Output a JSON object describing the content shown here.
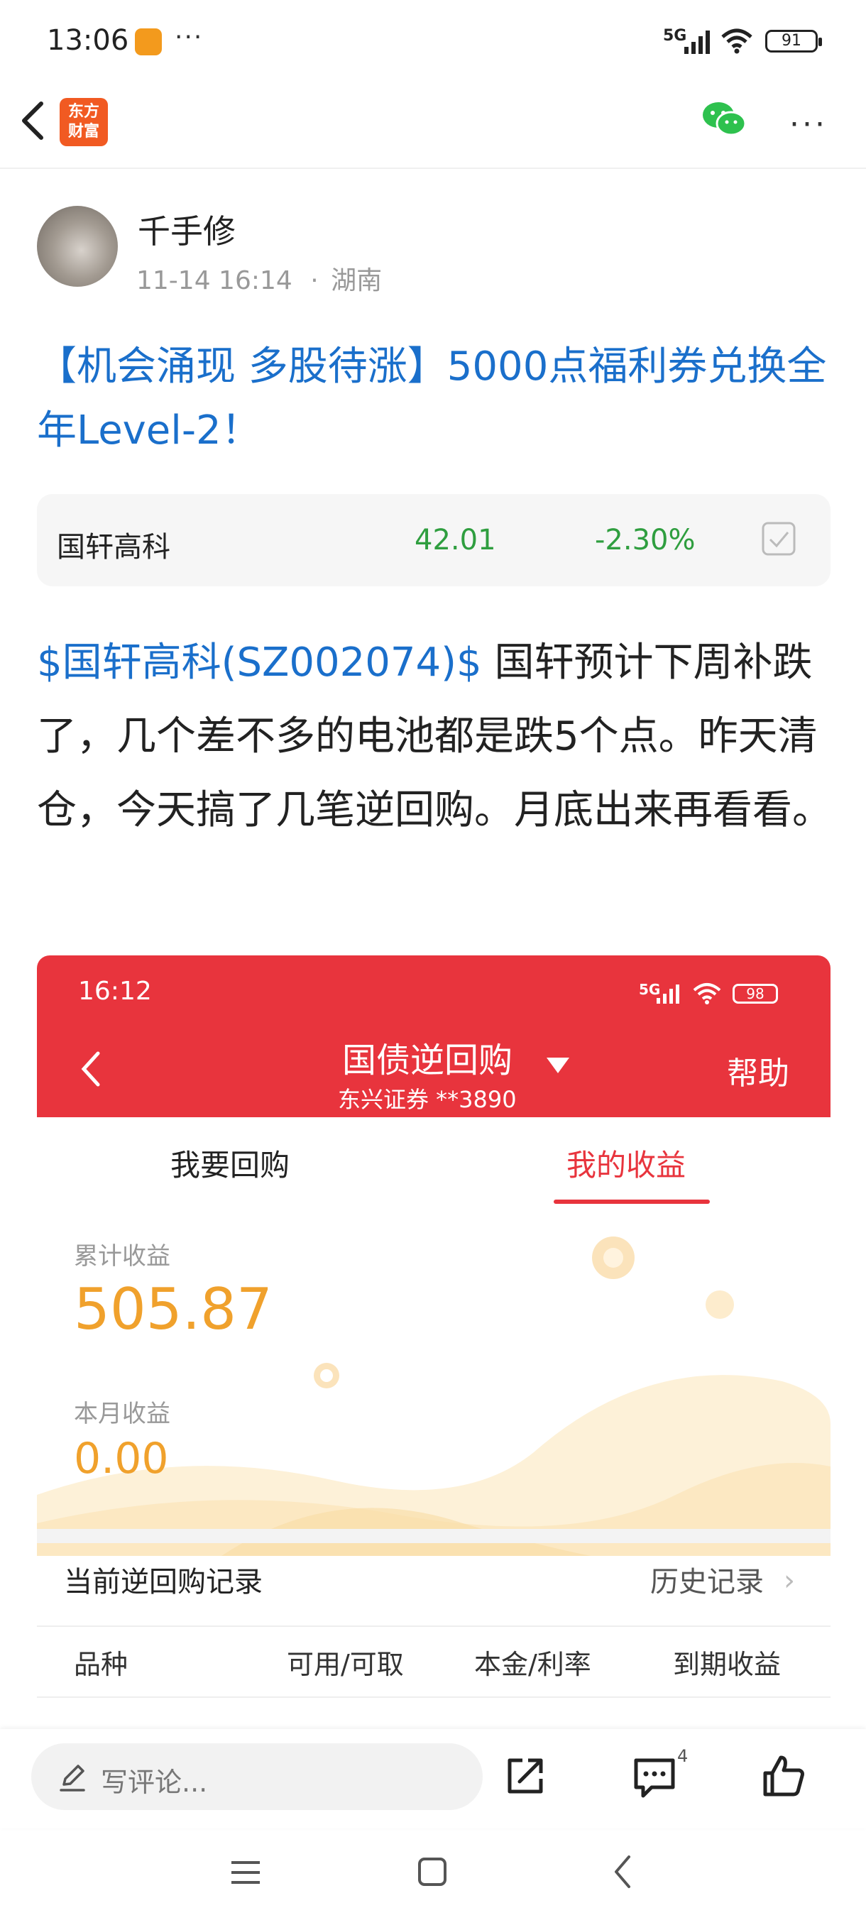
{
  "status_bar": {
    "time": "13:06",
    "dots": "···",
    "network": "5G",
    "battery": "91"
  },
  "nav": {
    "logo_line1": "东方",
    "logo_line2": "财富",
    "more": "···"
  },
  "post": {
    "author": "千手修",
    "time": "11-14 16:14",
    "location_sep": "·",
    "location": "湖南",
    "title": "【机会涌现 多股待涨】5000点福利券兑换全年Level-2！",
    "stock": {
      "name": "国轩高科",
      "price": "42.01",
      "change": "-2.30%"
    },
    "body_link": "$国轩高科(SZ002074)$",
    "body_text": " 国轩预计下周补跌了，几个差不多的电池都是跌5个点。昨天清仓，今天搞了几笔逆回购。月底出来再看看。"
  },
  "embedded": {
    "status_time": "16:12",
    "network": "5G",
    "battery": "98",
    "title": "国债逆回购",
    "account": "东兴证券 **3890",
    "help": "帮助",
    "tabs": [
      "我要回购",
      "我的收益"
    ],
    "total_label": "累计收益",
    "total_value": "505.87",
    "month_label": "本月收益",
    "month_value": "0.00",
    "records_title": "当前逆回购记录",
    "history": "历史记录",
    "columns": [
      "品种",
      "可用/可取",
      "本金/利率",
      "到期收益"
    ]
  },
  "bottom": {
    "comment_placeholder": "写评论...",
    "comment_count": "4"
  },
  "colors": {
    "link_blue": "#1a6fcb",
    "stock_green": "#2f9e3f",
    "header_red": "#e8343d",
    "earn_orange": "#f0a12c"
  }
}
